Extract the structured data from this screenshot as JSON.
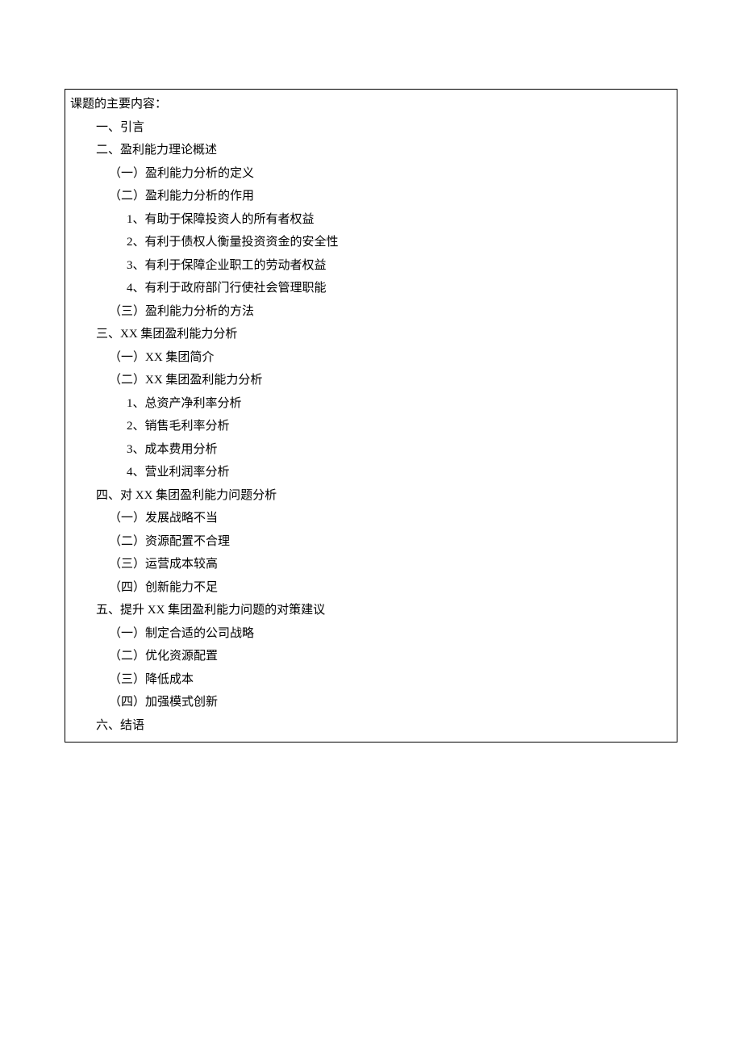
{
  "heading": "课题的主要内容：",
  "outline": [
    {
      "level": 1,
      "text": "一、引言"
    },
    {
      "level": 1,
      "text": "二、盈利能力理论概述"
    },
    {
      "level": 2,
      "text": "（一）盈利能力分析的定义"
    },
    {
      "level": 2,
      "text": "（二）盈利能力分析的作用"
    },
    {
      "level": 3,
      "text": "1、有助于保障投资人的所有者权益"
    },
    {
      "level": 3,
      "text": "2、有利于债权人衡量投资资金的安全性"
    },
    {
      "level": 3,
      "text": "3、有利于保障企业职工的劳动者权益"
    },
    {
      "level": 3,
      "text": "4、有利于政府部门行使社会管理职能"
    },
    {
      "level": 2,
      "text": "（三）盈利能力分析的方法"
    },
    {
      "level": 1,
      "text": "三、XX 集团盈利能力分析"
    },
    {
      "level": 2,
      "text": "（一）XX 集团简介"
    },
    {
      "level": 2,
      "text": "（二）XX 集团盈利能力分析"
    },
    {
      "level": 3,
      "text": "1、总资产净利率分析"
    },
    {
      "level": 3,
      "text": "2、销售毛利率分析"
    },
    {
      "level": 3,
      "text": "3、成本费用分析"
    },
    {
      "level": 3,
      "text": "4、营业利润率分析"
    },
    {
      "level": 1,
      "text": "四、对 XX 集团盈利能力问题分析"
    },
    {
      "level": 2,
      "text": "（一）发展战略不当"
    },
    {
      "level": 2,
      "text": "（二）资源配置不合理"
    },
    {
      "level": 2,
      "text": "（三）运营成本较高"
    },
    {
      "level": 2,
      "text": "（四）创新能力不足"
    },
    {
      "level": 1,
      "text": "五、提升 XX 集团盈利能力问题的对策建议"
    },
    {
      "level": 2,
      "text": "（一）制定合适的公司战略"
    },
    {
      "level": 2,
      "text": "（二）优化资源配置"
    },
    {
      "level": 2,
      "text": "（三）降低成本"
    },
    {
      "level": 2,
      "text": "（四）加强模式创新"
    },
    {
      "level": 1,
      "text": "六、结语"
    }
  ]
}
